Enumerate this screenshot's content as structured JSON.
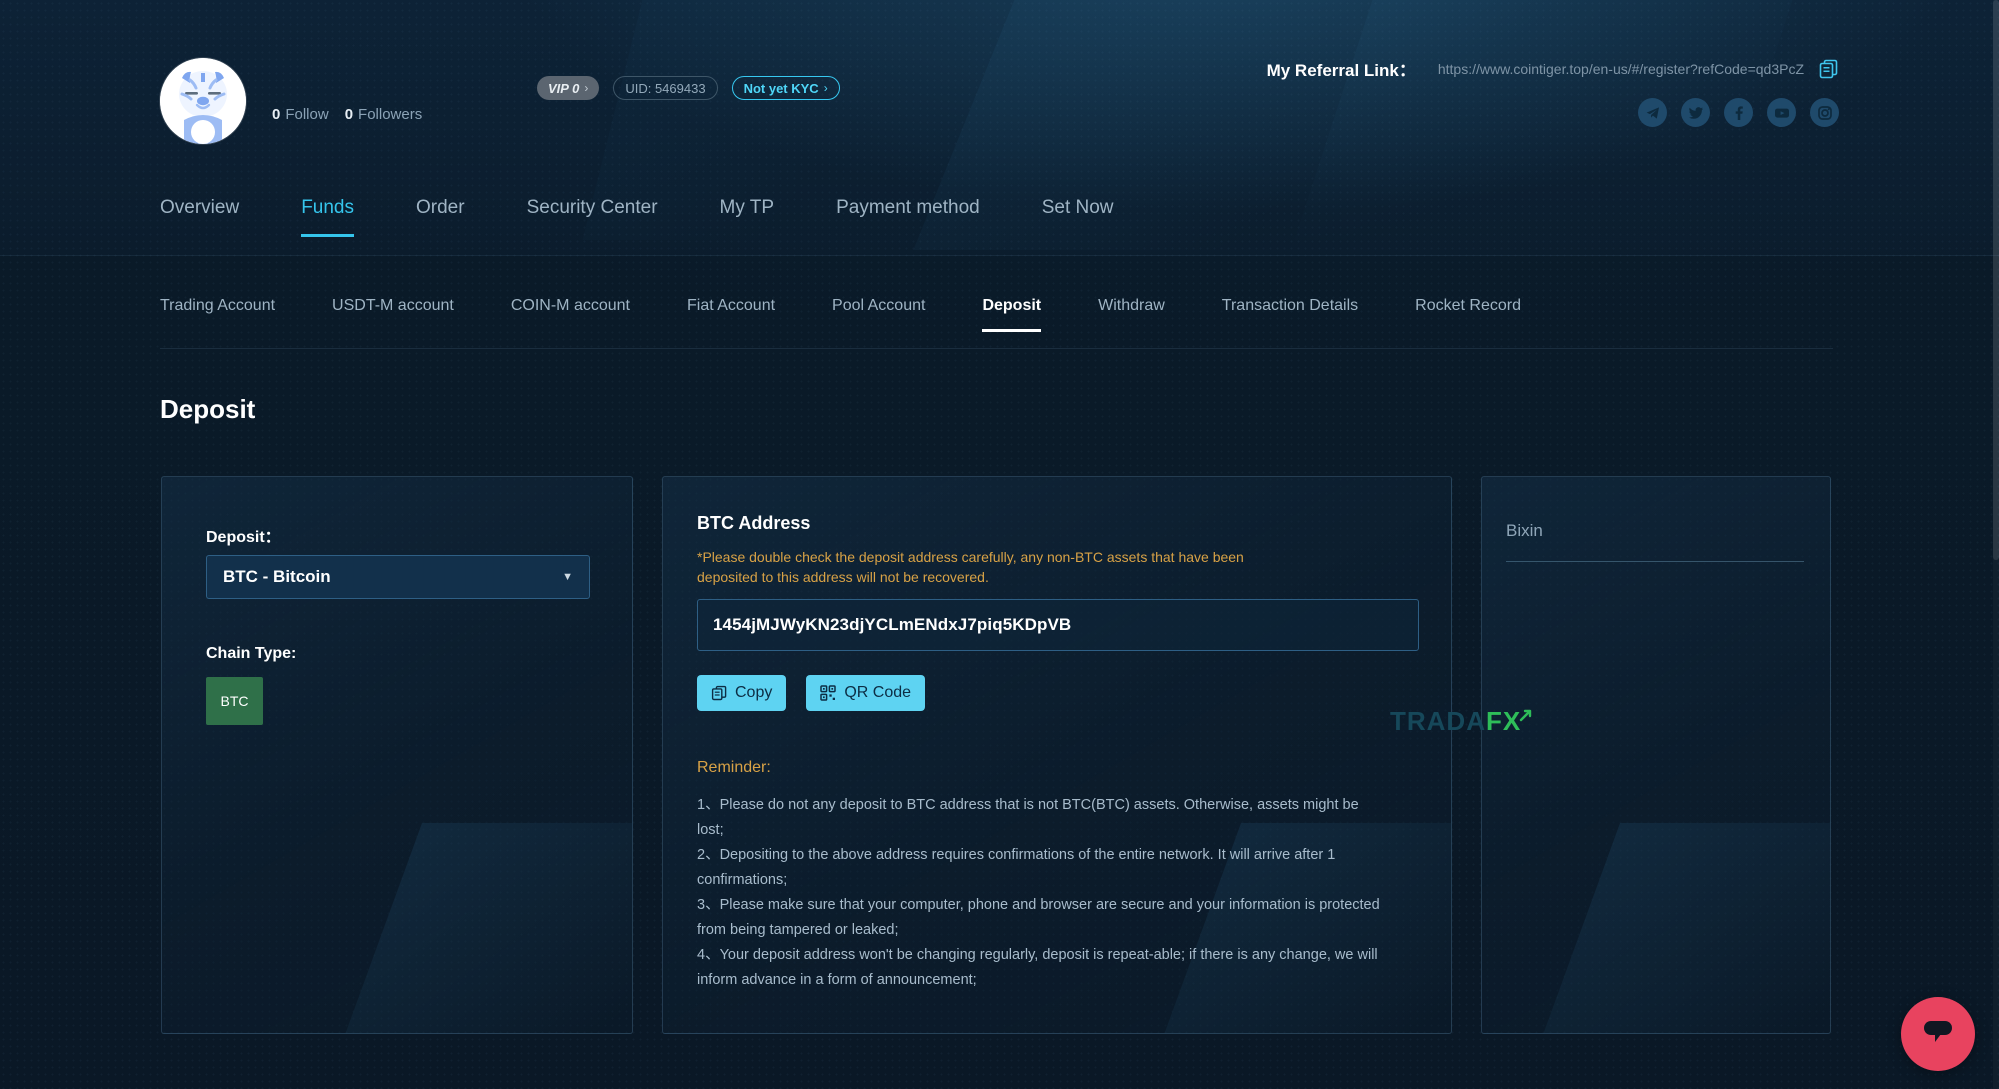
{
  "profile": {
    "avatar_alt": "tiger-avatar",
    "follow_count": "0",
    "follow_label": "Follow",
    "followers_count": "0",
    "followers_label": "Followers",
    "vip_badge": "VIP 0",
    "uid_badge": "UID: 5469433",
    "kyc_badge": "Not yet KYC",
    "chevron": "›"
  },
  "referral": {
    "label": "My Referral Link：",
    "url": "https://www.cointiger.top/en-us/#/register?refCode=qd3PcZ"
  },
  "socials": [
    {
      "name": "telegram"
    },
    {
      "name": "twitter"
    },
    {
      "name": "facebook"
    },
    {
      "name": "youtube"
    },
    {
      "name": "instagram"
    }
  ],
  "main_nav": [
    {
      "label": "Overview",
      "active": false
    },
    {
      "label": "Funds",
      "active": true
    },
    {
      "label": "Order",
      "active": false
    },
    {
      "label": "Security Center",
      "active": false
    },
    {
      "label": "My TP",
      "active": false
    },
    {
      "label": "Payment method",
      "active": false
    },
    {
      "label": "Set Now",
      "active": false
    }
  ],
  "sub_nav": [
    {
      "label": "Trading Account",
      "active": false
    },
    {
      "label": "USDT-M account",
      "active": false
    },
    {
      "label": "COIN-M account",
      "active": false
    },
    {
      "label": "Fiat Account",
      "active": false
    },
    {
      "label": "Pool Account",
      "active": false
    },
    {
      "label": "Deposit",
      "active": true
    },
    {
      "label": "Withdraw",
      "active": false
    },
    {
      "label": "Transaction Details",
      "active": false
    },
    {
      "label": "Rocket Record",
      "active": false
    }
  ],
  "page": {
    "title": "Deposit"
  },
  "deposit_form": {
    "deposit_label": "Deposit：",
    "selected_coin": "BTC - Bitcoin",
    "caret": "▼",
    "chain_type_label": "Chain Type:",
    "chain_options": [
      "BTC"
    ],
    "selected_chain": "BTC"
  },
  "address_panel": {
    "title": "BTC Address",
    "warning": "*Please double check the deposit address carefully, any non-BTC assets that have been deposited to this address will not be recovered.",
    "address": "1454jMJWyKN23djYCLmENdxJ7piq5KDpVB",
    "copy_label": "Copy",
    "qr_label": "QR Code",
    "reminder_title": "Reminder:",
    "reminders": [
      "1、Please do not any deposit to BTC address that is not BTC(BTC) assets. Otherwise, assets might be lost;",
      "2、Depositing to the above address requires confirmations of the entire network. It will arrive after 1 confirmations;",
      "3、Please make sure that your computer, phone and browser are secure and your information is protected from being tampered or leaked;",
      "4、Your deposit address won't be changing regularly, deposit is repeat-able; if there is any change, we will inform advance in a form of announcement;"
    ]
  },
  "side_panel": {
    "name": "Bixin"
  },
  "watermark": {
    "part_a": "TRADA",
    "part_b": "FX"
  },
  "chat": {
    "label": "chat-support"
  },
  "colors": {
    "accent_cyan": "#35c5ec",
    "button_cyan": "#5ed3f2",
    "warning_orange": "#d8a246",
    "chain_green": "#2f7049",
    "chat_pink": "#e8435f",
    "page_bg": "#0b1b2a"
  }
}
